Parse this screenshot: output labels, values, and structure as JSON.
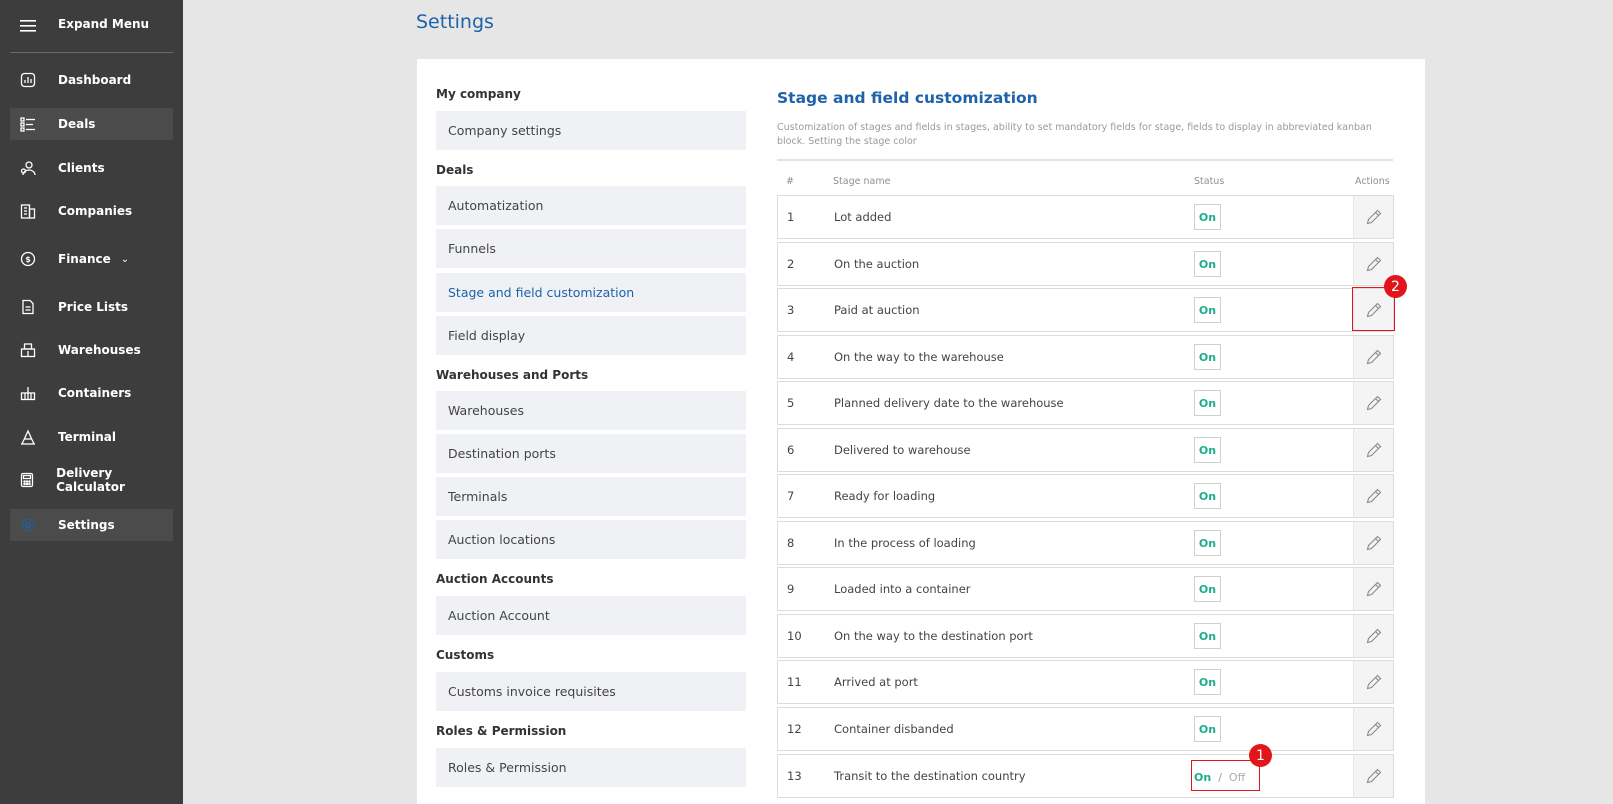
{
  "sidebar": {
    "expand_label": "Expand Menu",
    "items": [
      {
        "label": "Dashboard",
        "icon": "dashboard-icon"
      },
      {
        "label": "Deals",
        "icon": "deals-icon"
      },
      {
        "label": "Clients",
        "icon": "clients-icon"
      },
      {
        "label": "Companies",
        "icon": "companies-icon"
      },
      {
        "label": "Finance",
        "icon": "finance-icon"
      },
      {
        "label": "Price Lists",
        "icon": "price-lists-icon"
      },
      {
        "label": "Warehouses",
        "icon": "warehouses-icon"
      },
      {
        "label": "Containers",
        "icon": "containers-icon"
      },
      {
        "label": "Terminal",
        "icon": "terminal-icon"
      },
      {
        "label": "Delivery Calculator",
        "icon": "calculator-icon"
      },
      {
        "label": "Settings",
        "icon": "gear-icon"
      }
    ]
  },
  "page": {
    "title": "Settings"
  },
  "settings_menu": {
    "sections": [
      {
        "title": "My company",
        "items": [
          "Company settings"
        ]
      },
      {
        "title": "Deals",
        "items": [
          "Automatization",
          "Funnels",
          "Stage and field customization",
          "Field display"
        ]
      },
      {
        "title": "Warehouses and Ports",
        "items": [
          "Warehouses",
          "Destination ports",
          "Terminals",
          "Auction locations"
        ]
      },
      {
        "title": "Auction Accounts",
        "items": [
          "Auction Account"
        ]
      },
      {
        "title": "Customs",
        "items": [
          "Customs invoice requisites"
        ]
      },
      {
        "title": "Roles & Permission",
        "items": [
          "Roles & Permission"
        ]
      }
    ],
    "active_item": "Stage and field customization"
  },
  "stage_customization": {
    "title": "Stage and field customization",
    "description": "Customization of stages and fields in stages, ability to set mandatory fields for stage, fields to display in abbreviated kanban block. Setting the stage color",
    "columns": {
      "num": "#",
      "name": "Stage name",
      "status": "Status",
      "actions": "Actions"
    },
    "status_on": "On",
    "status_off": "Off",
    "toggle_sep": "/",
    "rows": [
      {
        "num": "1",
        "name": "Lot added"
      },
      {
        "num": "2",
        "name": "On the auction"
      },
      {
        "num": "3",
        "name": "Paid at auction"
      },
      {
        "num": "4",
        "name": "On the way to the warehouse"
      },
      {
        "num": "5",
        "name": "Planned delivery date to the warehouse"
      },
      {
        "num": "6",
        "name": "Delivered to warehouse"
      },
      {
        "num": "7",
        "name": "Ready for loading"
      },
      {
        "num": "8",
        "name": "In the process of loading"
      },
      {
        "num": "9",
        "name": "Loaded into a container"
      },
      {
        "num": "10",
        "name": "On the way to the destination port"
      },
      {
        "num": "11",
        "name": "Arrived at port"
      },
      {
        "num": "12",
        "name": "Container disbanded"
      },
      {
        "num": "13",
        "name": "Transit to the destination country"
      }
    ]
  },
  "annotations": {
    "badge_1": "1",
    "badge_2": "2"
  },
  "colors": {
    "accent": "#1e63a8",
    "status_on": "#1cae8a",
    "highlight": "#e2161a",
    "sidebar_bg": "#3d3d3d"
  }
}
